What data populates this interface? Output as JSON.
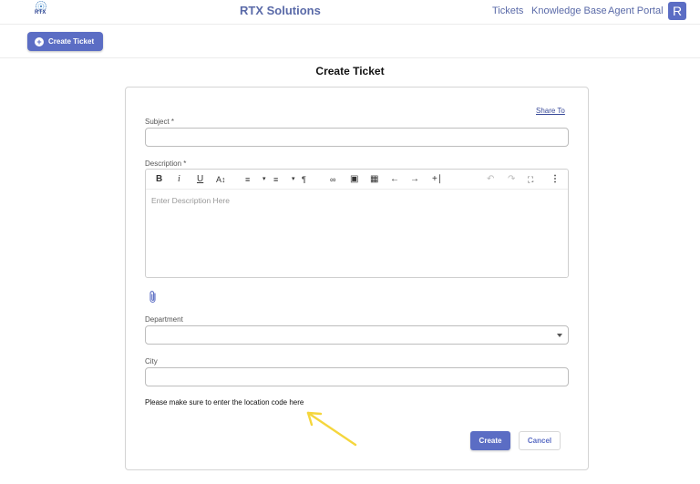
{
  "header": {
    "logo_text": "RTX",
    "brand": "RTX Solutions",
    "nav": {
      "tickets": "Tickets",
      "knowledge_base": "Knowledge Base",
      "agent_portal": "Agent Portal"
    },
    "avatar_initial": "R"
  },
  "toolbar": {
    "create_ticket_label": "Create Ticket",
    "create_ticket_icon": "plus-circle-icon"
  },
  "page": {
    "title": "Create Ticket"
  },
  "form": {
    "share_to": "Share To",
    "subject": {
      "label": "Subject *",
      "value": ""
    },
    "description": {
      "label": "Description *",
      "placeholder": "Enter Description Here",
      "editor_tools": [
        "bold-icon",
        "italic-icon",
        "underline-icon",
        "font-size-icon",
        "ordered-list-icon",
        "unordered-list-icon",
        "paragraph-format-icon",
        "link-icon",
        "image-icon",
        "table-icon",
        "outdent-icon",
        "indent-icon",
        "insert-icon",
        "undo-icon",
        "redo-icon",
        "fullscreen-icon",
        "more-icon"
      ]
    },
    "attachment_icon": "paperclip-icon",
    "department": {
      "label": "Department",
      "value": ""
    },
    "city": {
      "label": "City",
      "value": ""
    },
    "note": "Please make sure to enter the location code here",
    "create_label": "Create",
    "cancel_label": "Cancel"
  },
  "colors": {
    "accent": "#5b6dc4",
    "brand_text": "#5a6aa8",
    "annotation_arrow": "#f5d63d"
  }
}
